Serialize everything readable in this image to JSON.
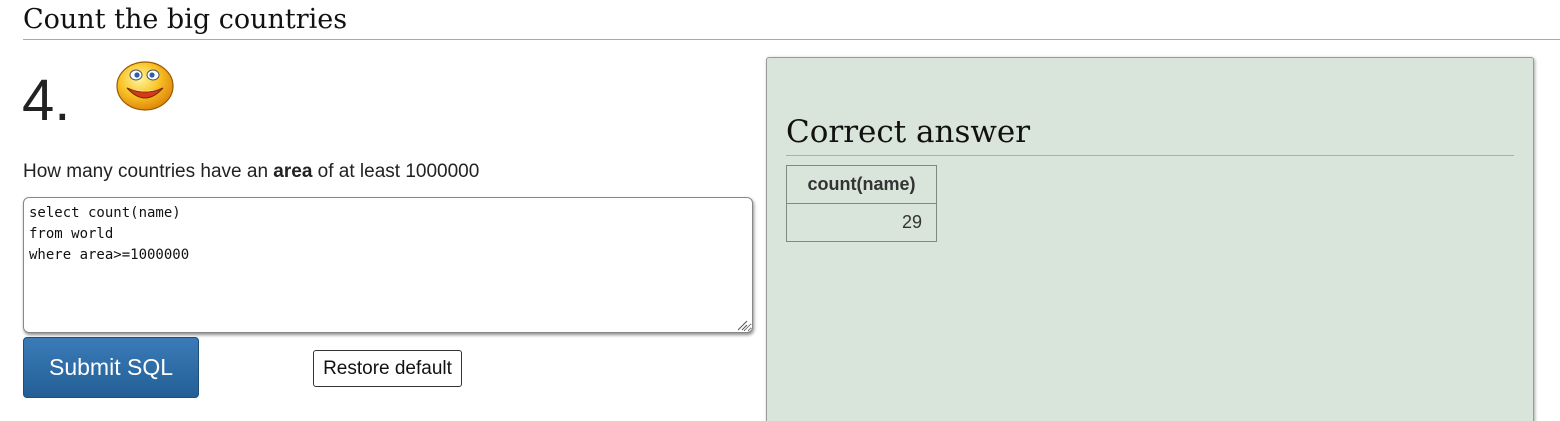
{
  "section": {
    "title": "Count the big countries"
  },
  "question": {
    "number": "4.",
    "prefix": "How many countries have an ",
    "keyword": "area",
    "suffix": " of at least 1000000",
    "status_icon": "smiley-correct-icon"
  },
  "editor": {
    "value": "select count(name)\nfrom world\nwhere area>=1000000"
  },
  "buttons": {
    "submit_label": "Submit SQL",
    "restore_label": "Restore default"
  },
  "answer": {
    "title": "Correct answer",
    "columns": [
      "count(name)"
    ],
    "rows": [
      [
        "29"
      ]
    ]
  },
  "colors": {
    "submit_button": "#2c6ca6",
    "answer_panel": "#d9e4da"
  }
}
